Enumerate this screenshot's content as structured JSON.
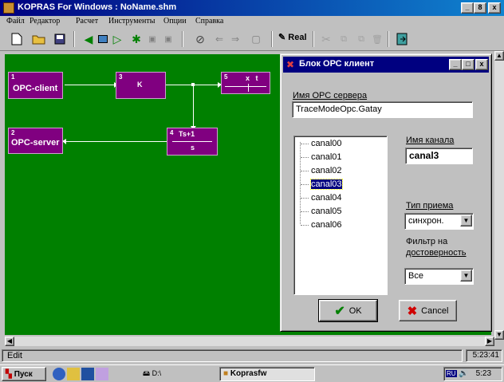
{
  "window": {
    "title": "KOPRAS For Windows : NoName.shm",
    "minimize": "_",
    "maximize": "8",
    "close": "x"
  },
  "menu": [
    "Файл",
    "Редактор",
    "Расчет",
    "Инструменты",
    "Опции",
    "Справка"
  ],
  "toolbar": {
    "real_label": "Real"
  },
  "blocks": [
    {
      "num": "1",
      "label": "OPC-client"
    },
    {
      "num": "3",
      "label": "K"
    },
    {
      "num": "5",
      "label": "x   t"
    },
    {
      "num": "2",
      "label": "OPC-server"
    },
    {
      "num": "4",
      "label_top": "Ts+1",
      "label_bottom": "s"
    }
  ],
  "dialog": {
    "title": "Блок ОРС клиент",
    "server_label": "Имя ОРС сервера",
    "server_value": "TraceModeOpc.Gatay",
    "channels": [
      "canal00",
      "canal01",
      "canal02",
      "canal03",
      "canal04",
      "canal05",
      "canal06"
    ],
    "selected_channel": "canal03",
    "channel_name_label": "Имя канала",
    "channel_name_value": "canal3",
    "receive_type_label": "Тип приема",
    "receive_type_value": "синхрон.",
    "filter_label_1": "Фильтр на",
    "filter_label_2": "достоверность",
    "filter_value": "Все",
    "ok_label": "OK",
    "cancel_label": "Cancel"
  },
  "status": {
    "mode": "Edit",
    "time": "5:23:41"
  },
  "taskbar": {
    "start": "Пуск",
    "drive_task": "D:\\",
    "kopras_task": "Koprasfw",
    "lang": "RU",
    "clock": "5:23"
  },
  "colors": {
    "canvas": "#008000",
    "block": "#800080",
    "titlebar": "#000080"
  }
}
